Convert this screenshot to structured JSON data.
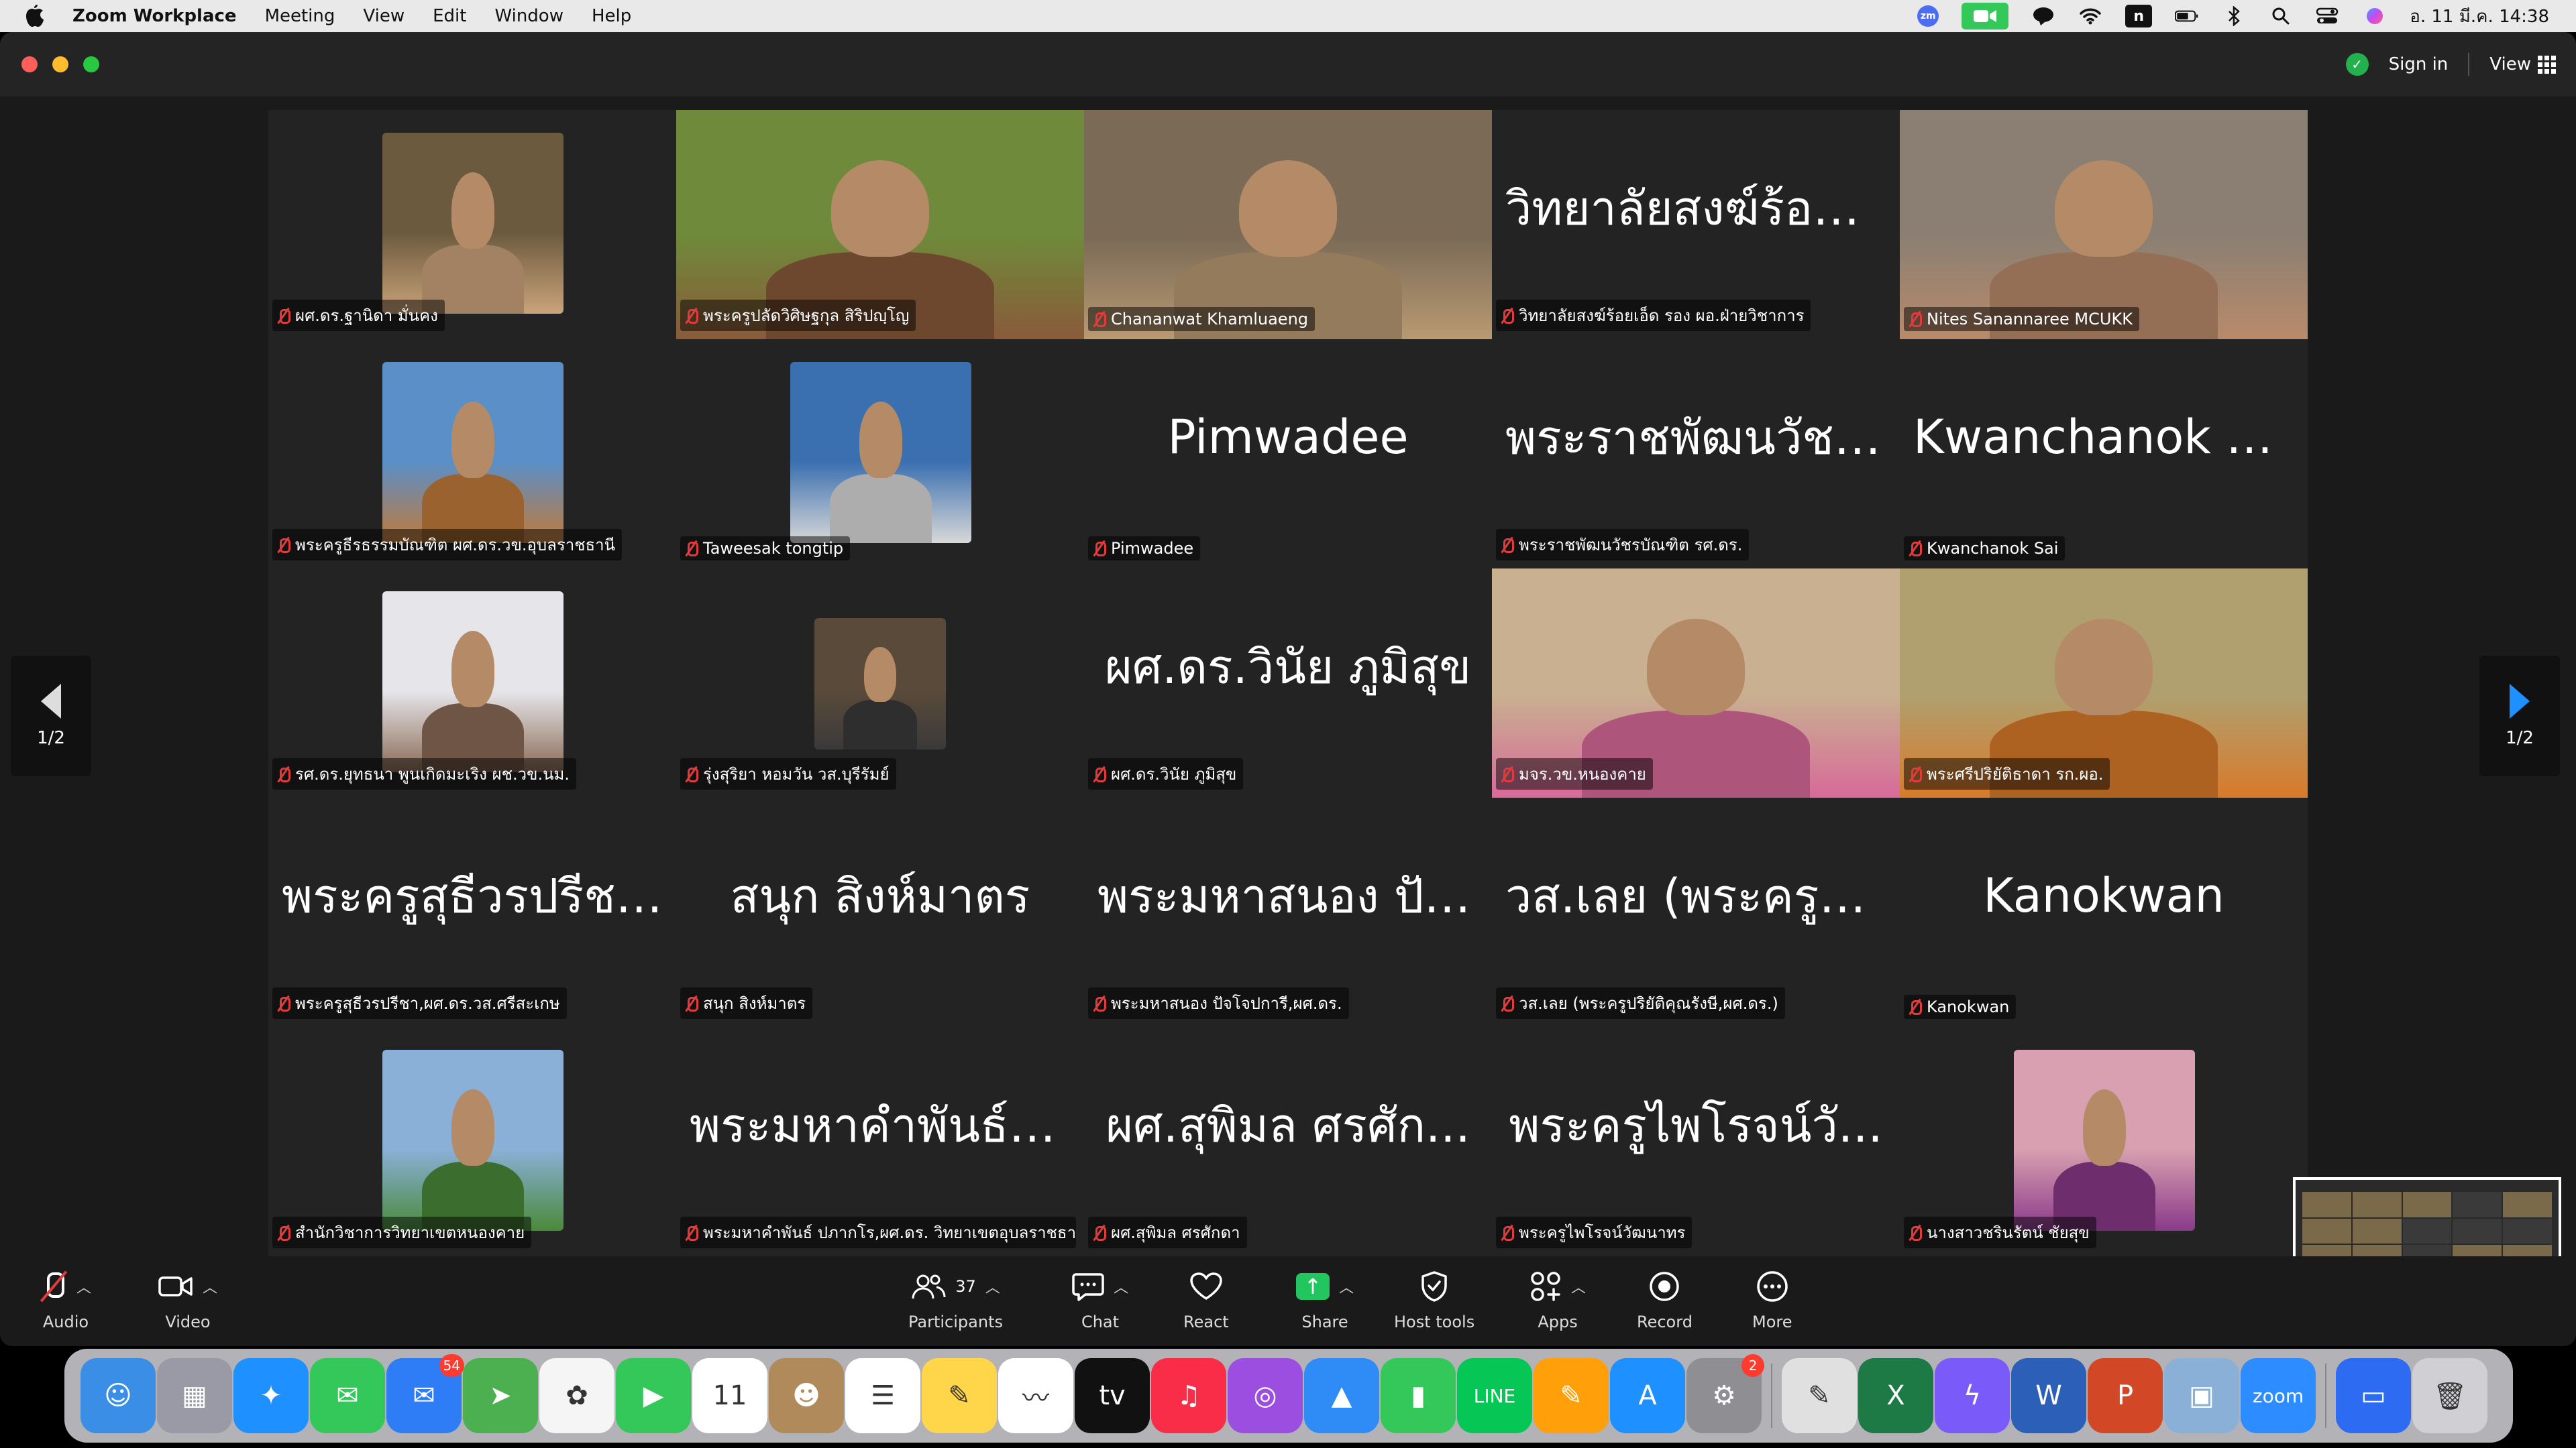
{
  "menubar": {
    "app_name": "Zoom Workplace",
    "menus": [
      "Meeting",
      "View",
      "Edit",
      "Window",
      "Help"
    ],
    "clock": "อ. 11 มี.ค.  14:38",
    "icons": [
      "zoom-icon",
      "camera-icon",
      "line-icon",
      "wifi-icon",
      "n-icon",
      "battery-icon",
      "bluetooth-icon",
      "search-icon",
      "control-center-icon",
      "siri-icon"
    ]
  },
  "titlebar": {
    "sign_in": "Sign in",
    "view": "View"
  },
  "pager": {
    "page": "1/2"
  },
  "tiles": [
    {
      "name": "ผศ.ดร.ฐานิดา มั่นคง",
      "video": "small",
      "colors": [
        "#6b5a3e",
        "#caa37a"
      ]
    },
    {
      "name": "พระครูปลัดวิศิษฐกุล สิริปญฺโญ",
      "video": "full",
      "colors": [
        "#6f8a3a",
        "#8a5a3a"
      ]
    },
    {
      "name": "Chananwat Khamluaeng",
      "video": "full",
      "colors": [
        "#7a6a56",
        "#b99a72"
      ]
    },
    {
      "name": "วิทยาลัยสงฆ์ร้อยเอ็ด รอง ผอ.ฝ่ายวิชาการ",
      "big": "วิทยาลัยสงฆ์ร้อยเ..."
    },
    {
      "name": "Nites Sanannaree MCUKK",
      "video": "full",
      "colors": [
        "#8a7f72",
        "#b98a6a"
      ]
    },
    {
      "name": "พระครูธีรธรรมบัณฑิต ผศ.ดร.วข.อุบลราชธานี",
      "video": "small",
      "colors": [
        "#5a8fc8",
        "#c07a3a"
      ]
    },
    {
      "name": "Taweesak tongtip",
      "video": "small",
      "colors": [
        "#3a6fb0",
        "#d8d8d8"
      ]
    },
    {
      "name": "Pimwadee",
      "big": "Pimwadee"
    },
    {
      "name": "พระราชพัฒนวัชรบัณฑิต รศ.ดร.",
      "big": "พระราชพัฒนวัชร..."
    },
    {
      "name": "Kwanchanok Sai",
      "big": "Kwanchanok Sai"
    },
    {
      "name": "รศ.ดร.ยุทธนา พูนเกิดมะเริง ผช.วข.นม.",
      "video": "small",
      "colors": [
        "#e6e6ea",
        "#8a6a56"
      ]
    },
    {
      "name": "รุ่งสุริยา หอมวัน วส.บุรีรัมย์",
      "video": "tiny",
      "colors": [
        "#5a4a3a",
        "#3a3a3a"
      ]
    },
    {
      "name": "ผศ.ดร.วินัย ภูมิสุข",
      "big": "ผศ.ดร.วินัย ภูมิสุข"
    },
    {
      "name": "มจร.วข.หนองคาย",
      "video": "full",
      "colors": [
        "#c8b090",
        "#d86a9a"
      ]
    },
    {
      "name": "พระศรีปริยัติธาดา รก.ผอ.",
      "video": "full",
      "colors": [
        "#b0a070",
        "#d87a2a"
      ]
    },
    {
      "name": "พระครูสุธีวรปรีชา,ผศ.ดร.วส.ศรีสะเกษ",
      "big": "พระครูสุธีวรปรีชา..."
    },
    {
      "name": "สนุก สิงห์มาตร",
      "big": "สนุก สิงห์มาตร"
    },
    {
      "name": "พระมหาสนอง ปัจโจปการี,ผศ.ดร.",
      "big": "พระมหาสนอง ปัจ..."
    },
    {
      "name": "วส.เลย (พระครูปริยัติคุณรังษี,ผศ.ดร.)",
      "big": "วส.เลย (พระครูปริ..."
    },
    {
      "name": "Kanokwan",
      "big": "Kanokwan"
    },
    {
      "name": "สำนักวิชาการวิทยาเขตหนองคาย",
      "video": "small",
      "colors": [
        "#8ab0d8",
        "#4a8a3a"
      ]
    },
    {
      "name": "พระมหาคำพันธ์ ปภากโร,ผศ.ดร. วิทยาเขตอุบลราชธานี",
      "big": "พระมหาคำพันธ์ ป..."
    },
    {
      "name": "ผศ.สุพิมล ศรศักดา",
      "big": "ผศ.สุพิมล ศรศัก..."
    },
    {
      "name": "พระครูไพโรจน์วัฒนาทร",
      "big": "พระครูไพโรจน์วั..."
    },
    {
      "name": "นางสาวชรินรัตน์ ชัยสุข",
      "video": "small",
      "colors": [
        "#d8a0b0",
        "#8a3a8a"
      ]
    }
  ],
  "toolbar": {
    "audio": "Audio",
    "video": "Video",
    "participants": "Participants",
    "participants_count": "37",
    "chat": "Chat",
    "react": "React",
    "share": "Share",
    "host_tools": "Host tools",
    "apps": "Apps",
    "record": "Record",
    "more": "More"
  },
  "dock": {
    "apps": [
      {
        "name": "finder",
        "color": "#3a8ee6",
        "glyph": "☺"
      },
      {
        "name": "launchpad",
        "color": "#9a9aa6",
        "glyph": "▦"
      },
      {
        "name": "safari",
        "color": "#1e90ff",
        "glyph": "✦"
      },
      {
        "name": "messages",
        "color": "#34c759",
        "glyph": "✉"
      },
      {
        "name": "mail",
        "color": "#2f7df6",
        "glyph": "✉",
        "badge": "54"
      },
      {
        "name": "maps",
        "color": "#4caf50",
        "glyph": "➤"
      },
      {
        "name": "photos",
        "color": "#f5f5f5",
        "glyph": "✿"
      },
      {
        "name": "facetime",
        "color": "#34c759",
        "glyph": "▶"
      },
      {
        "name": "calendar",
        "color": "#ffffff",
        "glyph": "11"
      },
      {
        "name": "contacts",
        "color": "#b08a5a",
        "glyph": "☻"
      },
      {
        "name": "reminders",
        "color": "#ffffff",
        "glyph": "☰"
      },
      {
        "name": "notes",
        "color": "#ffd54a",
        "glyph": "✎"
      },
      {
        "name": "freeform",
        "color": "#ffffff",
        "glyph": "〰"
      },
      {
        "name": "apple-tv",
        "color": "#111111",
        "glyph": "tv"
      },
      {
        "name": "music",
        "color": "#fa2d48",
        "glyph": "♫"
      },
      {
        "name": "podcasts",
        "color": "#9b4ee0",
        "glyph": "◎"
      },
      {
        "name": "keynote",
        "color": "#2f8cf6",
        "glyph": "▲"
      },
      {
        "name": "numbers",
        "color": "#34c759",
        "glyph": "▮"
      },
      {
        "name": "line",
        "color": "#06c755",
        "glyph": "LINE"
      },
      {
        "name": "pages",
        "color": "#ff9f0a",
        "glyph": "✎"
      },
      {
        "name": "app-store",
        "color": "#1e90ff",
        "glyph": "A"
      },
      {
        "name": "system-settings",
        "color": "#8e8e93",
        "glyph": "⚙",
        "badge": "2"
      },
      {
        "name": "script-editor",
        "color": "#e0e0e0",
        "glyph": "✎"
      },
      {
        "name": "excel",
        "color": "#1d7a45",
        "glyph": "X"
      },
      {
        "name": "messenger",
        "color": "#7a5af8",
        "glyph": "ϟ"
      },
      {
        "name": "word",
        "color": "#2b5fb8",
        "glyph": "W"
      },
      {
        "name": "powerpoint",
        "color": "#d24726",
        "glyph": "P"
      },
      {
        "name": "preview",
        "color": "#8ab0d8",
        "glyph": "▣"
      },
      {
        "name": "zoom",
        "color": "#2d8cff",
        "glyph": "zoom"
      },
      {
        "name": "zoom-meeting",
        "color": "#2d6cf2",
        "glyph": "▭"
      },
      {
        "name": "trash",
        "color": "#d0d0d4",
        "glyph": "🗑"
      }
    ]
  }
}
